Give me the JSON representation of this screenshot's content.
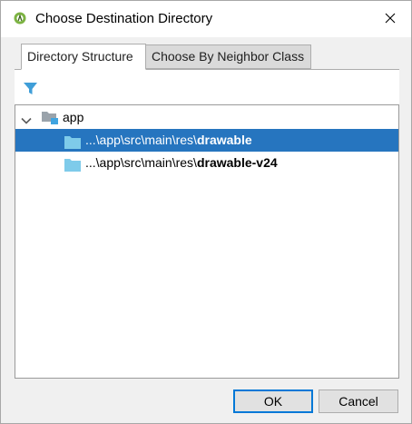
{
  "window": {
    "title": "Choose Destination Directory"
  },
  "tabs": [
    {
      "label": "Directory Structure",
      "selected": true
    },
    {
      "label": "Choose By Neighbor Class",
      "selected": false
    }
  ],
  "toolbar": {
    "filter_icon": "filter-icon"
  },
  "tree": {
    "root": {
      "label": "app",
      "expanded": true,
      "icon": "module-folder-icon"
    },
    "items": [
      {
        "prefix": "...\\app\\src\\main\\res\\",
        "name": "drawable",
        "selected": true,
        "icon": "folder-icon"
      },
      {
        "prefix": "...\\app\\src\\main\\res\\",
        "name": "drawable-v24",
        "selected": false,
        "icon": "folder-icon"
      }
    ]
  },
  "buttons": {
    "ok_label": "OK",
    "cancel_label": "Cancel"
  },
  "colors": {
    "selection": "#2675bf",
    "folder": "#7ecbea",
    "filter": "#3f9ed8",
    "default_button_border": "#0078d7",
    "app_icon": "#7cb342"
  }
}
